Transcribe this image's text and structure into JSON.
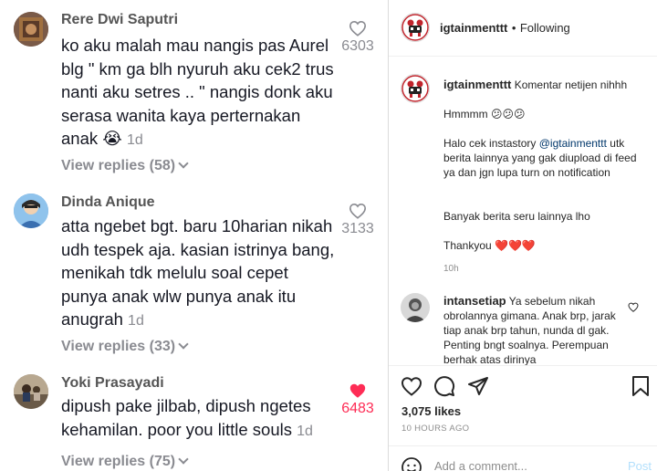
{
  "comments": [
    {
      "username": "Rere Dwi Saputri",
      "text": "ko aku malah mau nangis pas Aurel blg \" km ga blh nyuruh aku cek2 trus nanti aku setres .. \" nangis donk aku serasa wanita kaya perternakan anak 😭",
      "time": "1d",
      "replies": "View replies (58)",
      "likes": "6303",
      "liked": false
    },
    {
      "username": "Dinda Anique",
      "text": "atta ngebet bgt. baru 10harian nikah udh tespek aja. kasian istrinya bang, menikah tdk melulu soal cepet punya anak wlw punya anak itu anugrah",
      "time": "1d",
      "replies": "View replies (33)",
      "likes": "3133",
      "liked": false
    },
    {
      "username": "Yoki Prasayadi",
      "text": "dipush pake jilbab, dipush ngetes kehamilan. poor you little souls",
      "time": "1d",
      "replies": "View replies (75)",
      "likes": "6483",
      "liked": true
    }
  ],
  "instagram": {
    "username": "igtainmenttt",
    "dot": "•",
    "following": "Following",
    "caption_first": "Komentar netijen nihhh",
    "caption_hmm": "Hmmmm 😕😕😕",
    "caption_halo_pre": "Halo cek instastory ",
    "caption_mention": "@igtainmenttt",
    "caption_halo_post": " utk berita lainnya yang gak diupload di feed ya dan jgn lupa turn on notification",
    "caption_banyak": "Banyak berita seru lainnya lho",
    "caption_thanks": "Thankyou ❤️❤️❤️",
    "caption_time": "10h",
    "comment_user": "intansetiap",
    "comment_text": "Ya sebelum nikah obrolannya gimana. Anak brp, jarak tiap anak brp tahun, nunda dl gak. Penting bngt soalnya. Perempuan berhak atas dirinya",
    "likes": "3,075 likes",
    "post_time": "10 HOURS AGO",
    "add_comment_placeholder": "Add a comment...",
    "post_label": "Post",
    "accent_color": "#0095f6",
    "like_color": "#fe2c55"
  }
}
